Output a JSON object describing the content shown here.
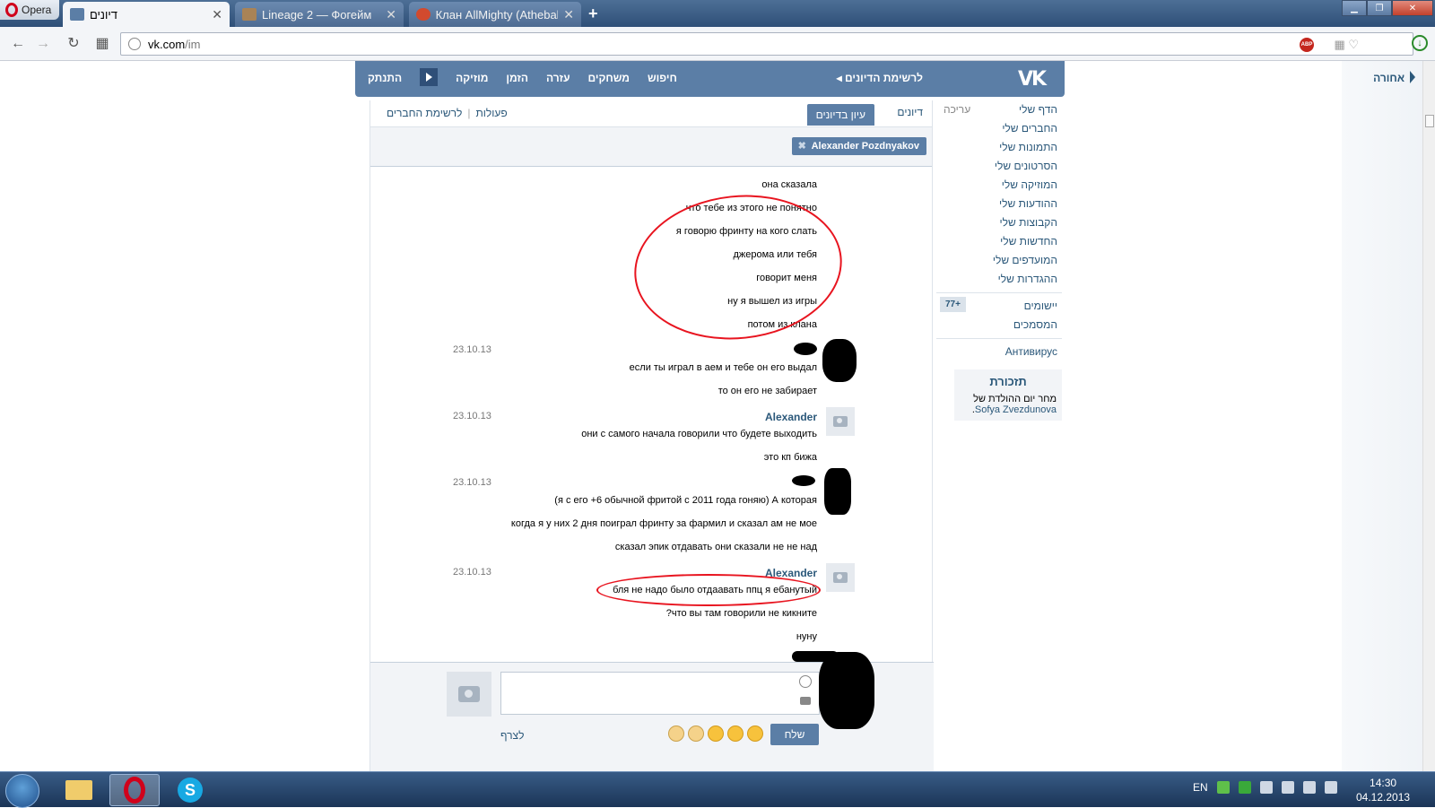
{
  "browser": {
    "menu_label": "Opera",
    "tabs": [
      {
        "title": "דיונים",
        "active": true
      },
      {
        "title": "Lineage 2 — Фогейм",
        "active": false
      },
      {
        "title": "Клан AllMighty (Athebald",
        "active": false
      }
    ],
    "new_tab_icon": "+",
    "url_host": "vk.com",
    "url_path": "/im",
    "abp_label": "ABP"
  },
  "vk": {
    "back_to_dialogs": "לרשימת הדיונים",
    "menu": [
      "חיפוש",
      "משחקים",
      "עזרה",
      "הזמן",
      "מוזיקה",
      "התנתק"
    ],
    "sidebar": {
      "edit": "עריכה",
      "items": [
        "הדף שלי",
        "החברים שלי",
        "התמונות שלי",
        "הסרטונים שלי",
        "המוזיקה שלי",
        "ההודעות שלי",
        "הקבוצות שלי",
        "החדשות שלי",
        "המועדפים שלי",
        "ההגדרות שלי"
      ],
      "apps": "יישומים",
      "apps_badge": "+77",
      "docs": "המסמכים",
      "antivirus": "Антивирус"
    },
    "reminder": {
      "title": "תזכורת",
      "text": "מחר יום ההולדת של",
      "name": "Sofya Zvezdunova",
      "dot": "."
    },
    "back_right": "אחורה",
    "dialog": {
      "tab_dialogs": "דיונים",
      "tab_view": "עיון בדיונים",
      "actions": "פעולות",
      "friends_list": "לרשימת החברים",
      "peer": "Alexander Pozdnyakov"
    },
    "messages": {
      "l0": "она сказала",
      "l1": "что тебе из этого не понятно",
      "l2": "я говорю фринту на кого слать",
      "l3": "джерома или тебя",
      "l4": "говорит меня",
      "l5": "ну я вышел из игры",
      "l6": "потом из клана",
      "d1": "23.10.13",
      "l7": "если ты играл в аем и тебе он его выдал",
      "l8": "то он его не забирает",
      "d2": "23.10.13",
      "n2": "Alexander",
      "l9": "они с самого начала говорили что будете выходить",
      "l10": "это кп бижа",
      "d3": "23.10.13",
      "l11": "(я с его +6 обычной фритой с 2011 года гоняю) А которая",
      "l12": "когда я у них 2 дня поиграл фринту за фармил и сказал ам не мое",
      "l13": "сказал эпик отдавать они сказали не не над",
      "d4": "23.10.13",
      "n4": "Alexander",
      "l14": "бля не надо было отдаавать ппц я ебанутый",
      "l15": "?что вы там говорили не кикните",
      "l16": "нуну"
    },
    "compose": {
      "send": "שלח",
      "attach": "לצרף"
    }
  },
  "taskbar": {
    "lang": "EN",
    "time": "14:30",
    "date": "04.12.2013"
  }
}
